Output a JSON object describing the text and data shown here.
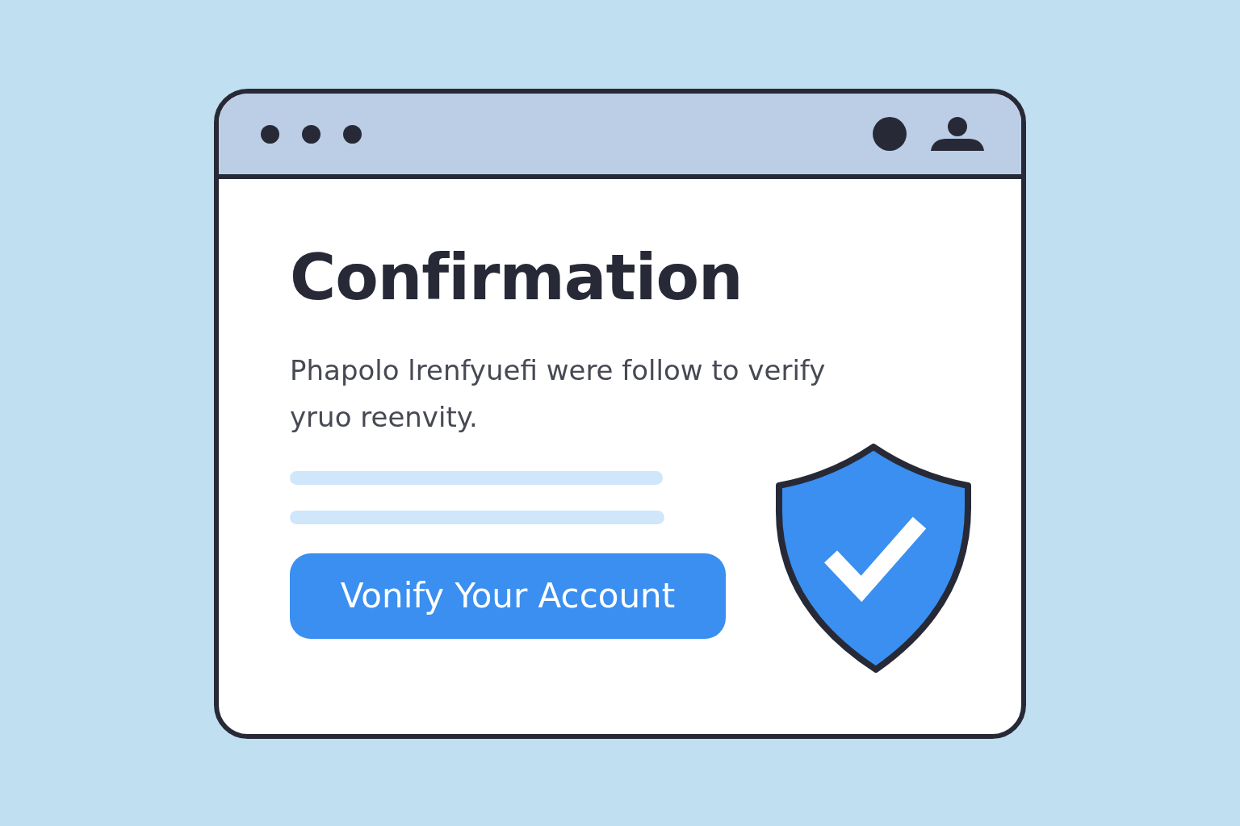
{
  "page": {
    "heading": "Confirmation",
    "message": "Phapolo lrenfyuefi were follow to verify yruo reenvity.",
    "button": {
      "label": "Vonify Your Account"
    }
  }
}
